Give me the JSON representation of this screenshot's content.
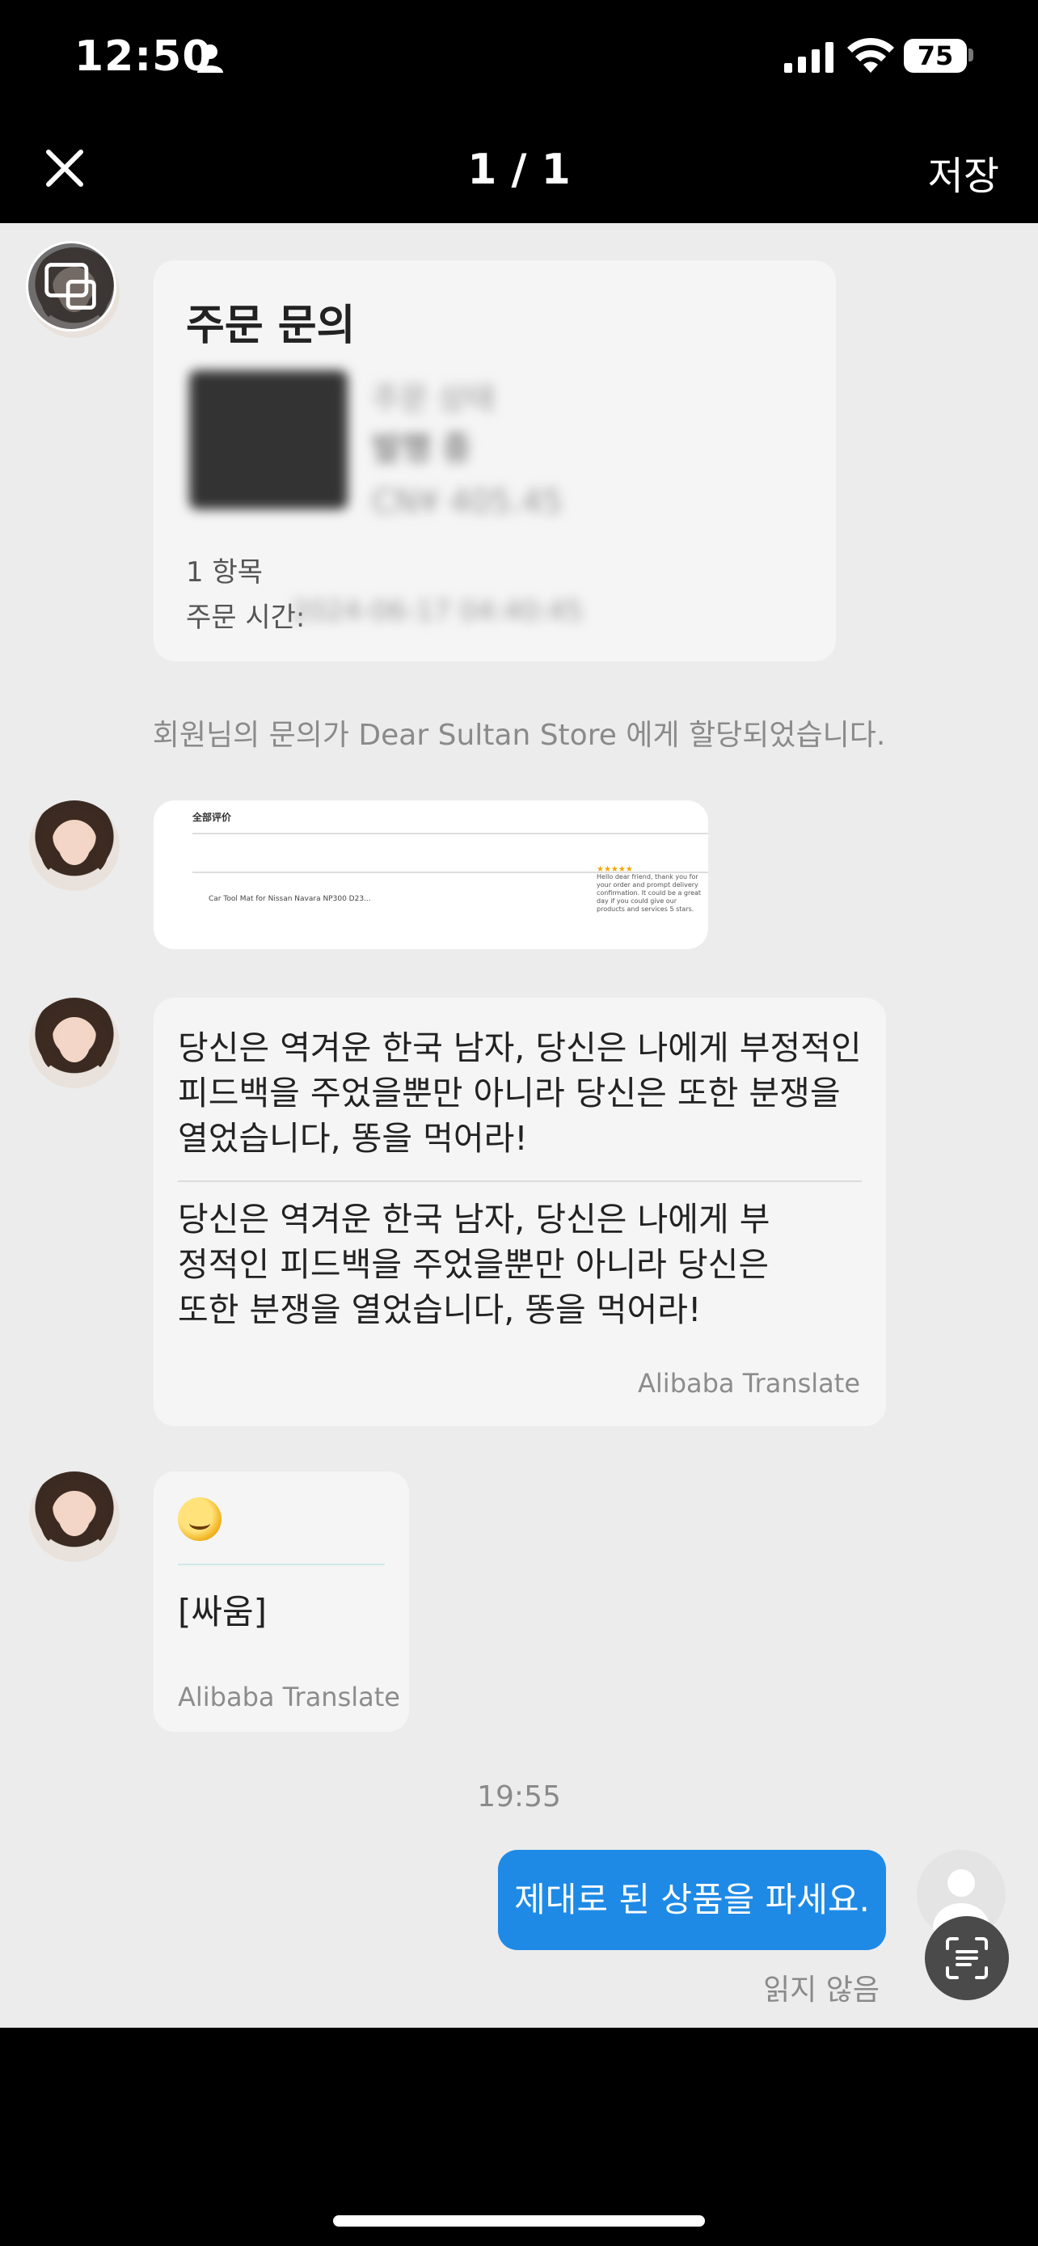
{
  "status_bar": {
    "time": "12:50",
    "battery": "75"
  },
  "nav": {
    "title": "1 / 1",
    "save_label": "저장"
  },
  "order_card": {
    "title": "주문 문의",
    "status_line1": "주문 상태",
    "status_line2": "발행 중",
    "price": "CN¥ 405.45",
    "items": "1 항목",
    "time_label": "주문 시간:",
    "time_value": "2024-06-17 04:40:45"
  },
  "system_note": "회원님의 문의가 Dear Sultan Store 에게 할당되었습니다.",
  "screenshot_card": {
    "header": "全部评价",
    "product": "Car Tool Mat for Nissan Navara NP300 D23...",
    "stars": "★★★★★",
    "review_text": "Hello dear friend, thank you for your order and prompt delivery confirmation. It could be a great day if you could give our products and services 5 stars."
  },
  "message_abuse": {
    "original": "당신은 역겨운 한국 남자, 당신은 나에게 부정적인 피드백을 주었을뿐만 아니라 당신은 또한 분쟁을 열었습니다, 똥을 먹어라!",
    "translated": "당신은 역겨운 한국 남자, 당신은 나에게 부정적인 피드백을 주었을뿐만 아니라 당신은 또한 분쟁을 열었습니다, 똥을 먹어라!",
    "translate_tag": "Alibaba Translate"
  },
  "message_fight": {
    "text": "[싸움]",
    "translate_tag": "Alibaba Translate"
  },
  "time_separator": "19:55",
  "sent_message": {
    "text": "제대로 된 상품을 파세요.",
    "read_status": "읽지 않음"
  }
}
